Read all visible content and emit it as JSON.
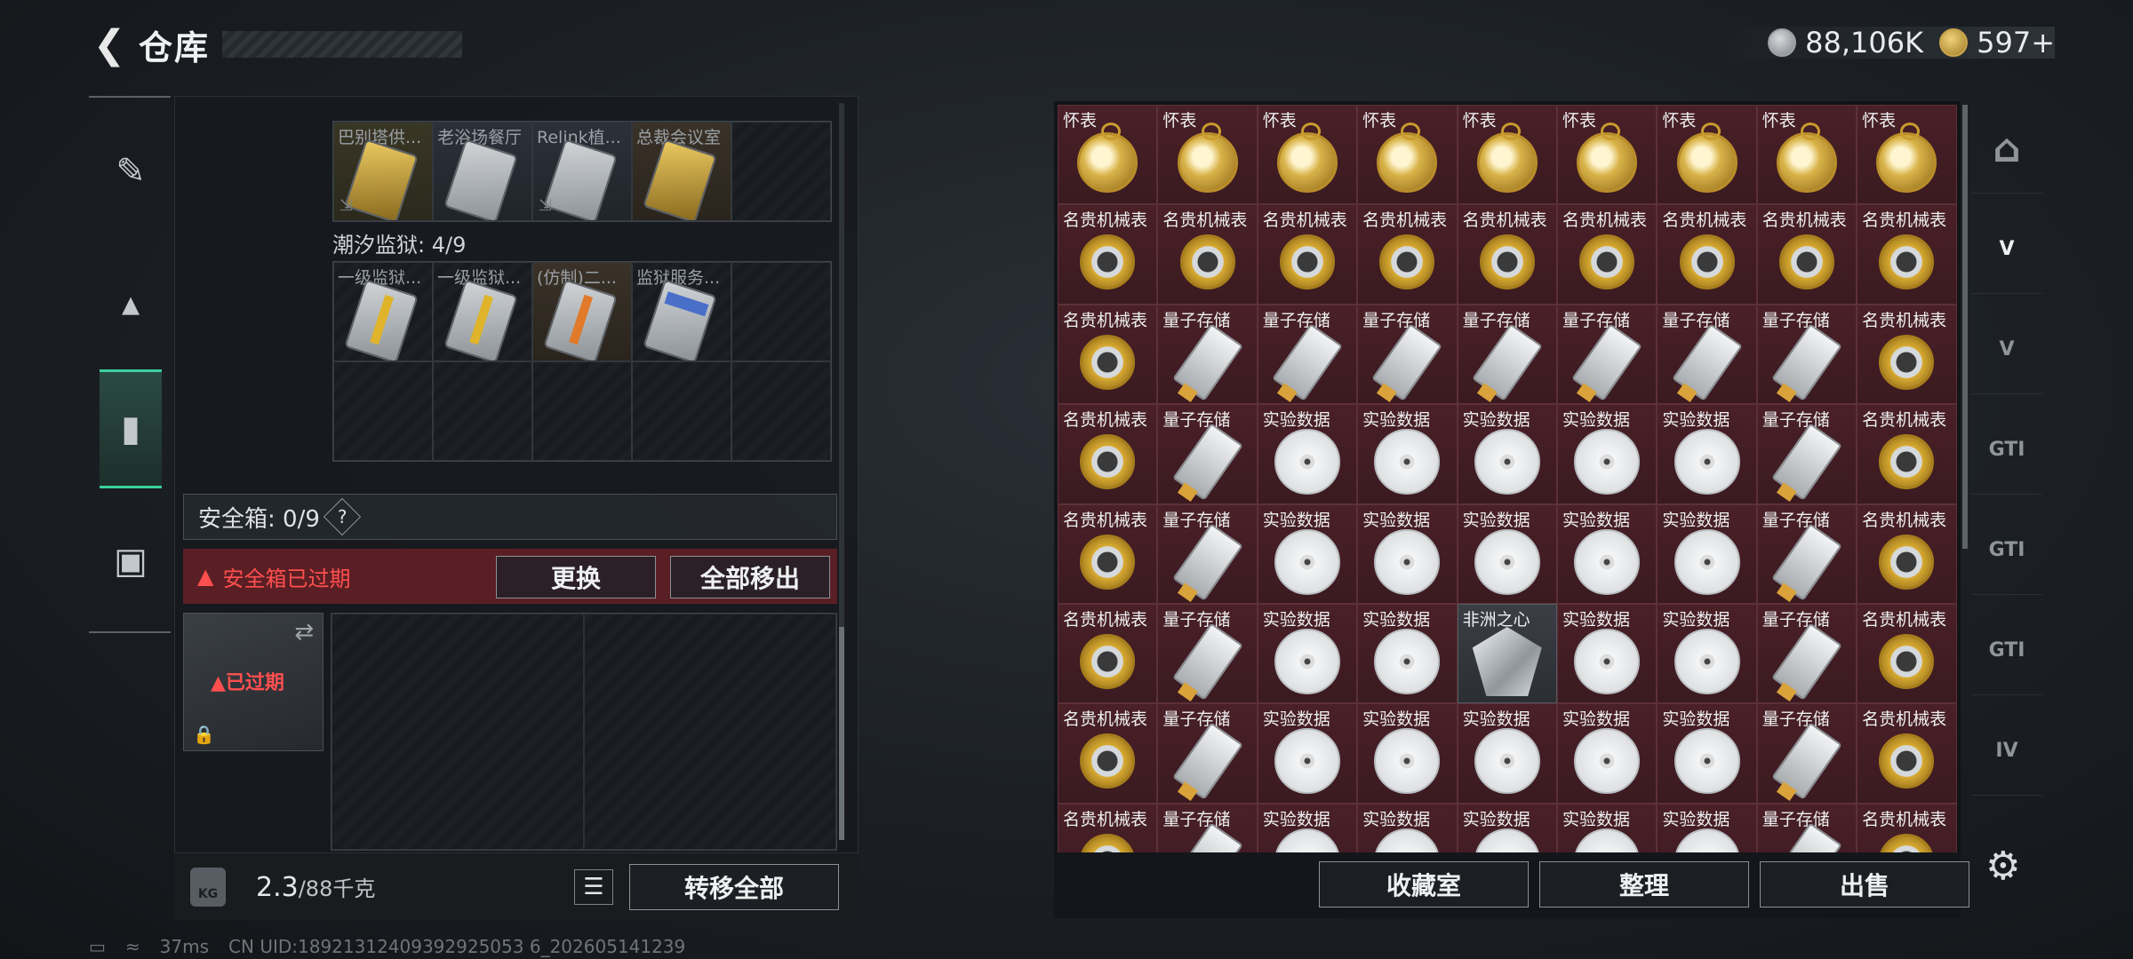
{
  "header": {
    "title": "仓库",
    "back_icon": "back-arrow-icon"
  },
  "currency": [
    {
      "icon": "silver-coin-icon",
      "value": "88,106K"
    },
    {
      "icon": "gold-coin-icon",
      "value": "597+"
    }
  ],
  "left_nav": [
    {
      "icon": "pistol-icon",
      "active": false
    },
    {
      "icon": "armor-vest-icon",
      "active": false
    },
    {
      "icon": "backpack-icon",
      "active": true
    },
    {
      "icon": "toolbox-icon",
      "active": false
    }
  ],
  "keycards_top": {
    "cells": [
      {
        "label": "巴别塔供...",
        "type": "gold"
      },
      {
        "label": "老浴场餐厅",
        "type": "silver"
      },
      {
        "label": "Relink植...",
        "type": "silver"
      },
      {
        "label": "总裁会议室",
        "type": "gold"
      },
      {
        "label": "",
        "type": "empty"
      }
    ]
  },
  "prison": {
    "label": "潮汐监狱: 4/9",
    "cells": [
      {
        "label": "一级监狱...",
        "type": "yellowband"
      },
      {
        "label": "一级监狱...",
        "type": "yellowband"
      },
      {
        "label": "(仿制)二...",
        "type": "orangeband"
      },
      {
        "label": "监狱服务...",
        "type": "blueband"
      }
    ]
  },
  "safe": {
    "label": "安全箱: 0/9",
    "help": "?",
    "expired_warning": "安全箱已过期",
    "replace_button": "更换",
    "remove_all_button": "全部移出",
    "expired_tag": "已过期"
  },
  "bottom": {
    "weight_value": "2.3",
    "weight_max": "/88千克",
    "kg_label": "KG",
    "transfer_all": "转移全部"
  },
  "status": {
    "ping": "37ms",
    "uid": "CN UID:18921312409392925053 6_202605141239"
  },
  "items": [
    [
      "怀表",
      "怀表",
      "怀表",
      "怀表",
      "怀表",
      "怀表",
      "怀表",
      "怀表",
      "怀表"
    ],
    [
      "名贵机械表",
      "名贵机械表",
      "名贵机械表",
      "名贵机械表",
      "名贵机械表",
      "名贵机械表",
      "名贵机械表",
      "名贵机械表",
      "名贵机械表"
    ],
    [
      "名贵机械表",
      "量子存储",
      "量子存储",
      "量子存储",
      "量子存储",
      "量子存储",
      "量子存储",
      "量子存储",
      "名贵机械表"
    ],
    [
      "名贵机械表",
      "量子存储",
      "实验数据",
      "实验数据",
      "实验数据",
      "实验数据",
      "实验数据",
      "量子存储",
      "名贵机械表"
    ],
    [
      "名贵机械表",
      "量子存储",
      "实验数据",
      "实验数据",
      "实验数据",
      "实验数据",
      "实验数据",
      "量子存储",
      "名贵机械表"
    ],
    [
      "名贵机械表",
      "量子存储",
      "实验数据",
      "实验数据",
      "非洲之心",
      "实验数据",
      "实验数据",
      "量子存储",
      "名贵机械表"
    ],
    [
      "名贵机械表",
      "量子存储",
      "实验数据",
      "实验数据",
      "实验数据",
      "实验数据",
      "实验数据",
      "量子存储",
      "名贵机械表"
    ],
    [
      "名贵机械表",
      "量子存储",
      "实验数据",
      "实验数据",
      "实验数据",
      "实验数据",
      "实验数据",
      "量子存储",
      "名贵机械表"
    ]
  ],
  "right_actions": {
    "collection": "收藏室",
    "sort": "整理",
    "sell": "出售"
  },
  "right_tabs": [
    {
      "label": "",
      "icon": "house-icon"
    },
    {
      "label": "V",
      "icon": "garage-v-icon"
    },
    {
      "label": "V",
      "icon": "garage-v-icon"
    },
    {
      "label": "GTI",
      "icon": "garage-gti-icon"
    },
    {
      "label": "GTI",
      "icon": "garage-gti-icon"
    },
    {
      "label": "GTI",
      "icon": "garage-gti-icon"
    },
    {
      "label": "IV",
      "icon": "garage-iv-icon"
    }
  ]
}
